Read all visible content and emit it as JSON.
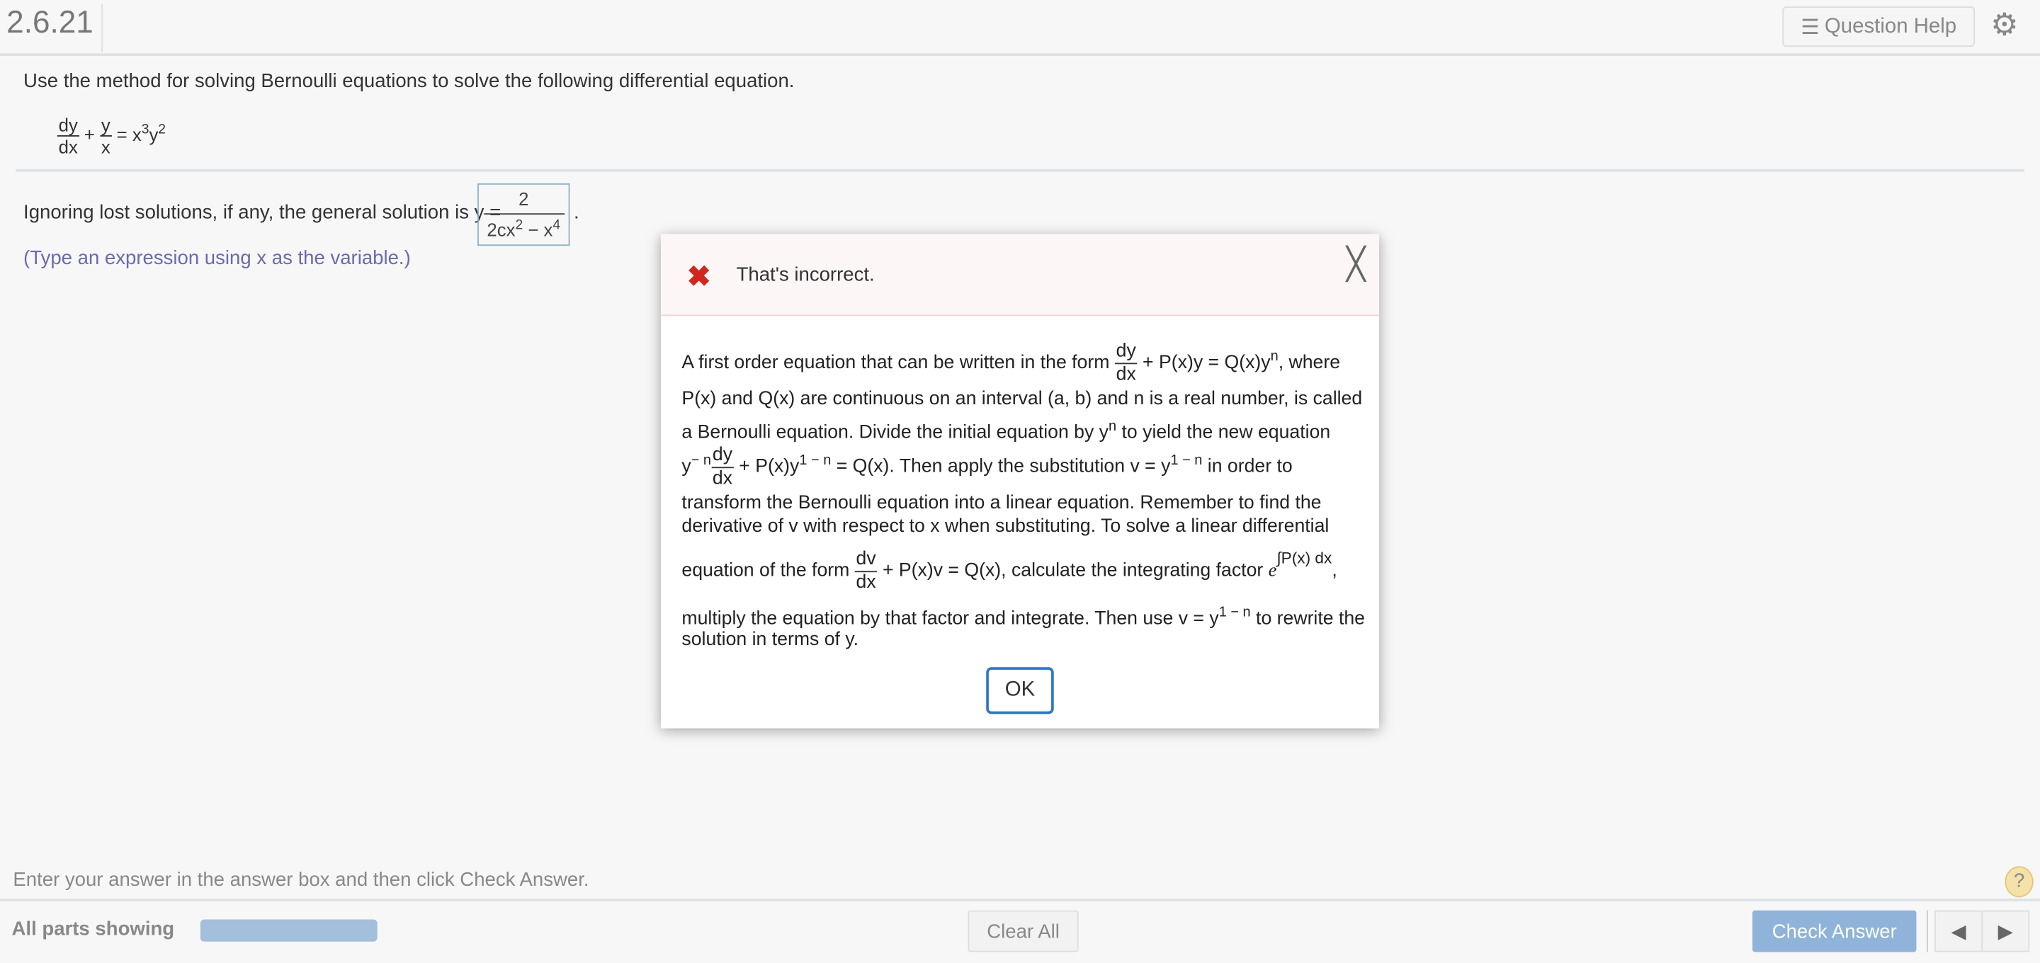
{
  "header": {
    "title": "2.6.21",
    "question_help": "Question Help",
    "icons": {
      "help": "list-icon",
      "settings": "gear-icon"
    }
  },
  "question": {
    "instruction": "Use the method for solving Bernoulli equations to solve the following differential equation.",
    "equation": {
      "num1": "dy",
      "den1": "dx",
      "plus": "+",
      "num2": "y",
      "den2": "x",
      "rhs": "= x",
      "exp1": "3",
      "y": "y",
      "exp2": "2"
    },
    "answer_prompt": "Ignoring lost solutions, if any, the general solution is y =",
    "answer": {
      "numerator": "2",
      "denominator": "2cx",
      "exp_a": "2",
      "minus": " − x",
      "exp_b": "4"
    },
    "period": ".",
    "hint": "(Type an expression using x as the variable.)"
  },
  "dialog": {
    "status": "That's incorrect.",
    "status_color": "#d0281f",
    "l1a": "A first order equation that can be written in the form ",
    "dy": "dy",
    "dx": "dx",
    "l1b": " + P(x)y = Q(x)y",
    "n": "n",
    "l1c": ", where",
    "l2": "P(x) and Q(x) are continuous on an interval (a, b) and n is a real number, is called",
    "l3a": "a Bernoulli equation. Divide the initial equation by y",
    "l3b": " to yield the new equation",
    "l4a": "y",
    "l4exp": "− n",
    "l4b": " + P(x)y",
    "l4exp2": "1 − n",
    "l4c": " = Q(x). Then apply the substitution v = y",
    "l4d": " in order to",
    "l5": "transform the Bernoulli equation into a linear equation. Remember to find the",
    "l6": "derivative of v with respect to x when substituting. To solve a linear differential",
    "l7a": "equation of the form ",
    "dv": "dv",
    "l7b": " + P(x)v = Q(x), calculate the integrating factor ",
    "e": "e",
    "integral": "∫P(x) dx",
    "comma": ",",
    "l8a": "multiply the equation by that factor and integrate. Then use v = y",
    "l8b": " to rewrite the",
    "l9": "solution in terms of y.",
    "ok": "OK"
  },
  "footer": {
    "message": "Enter your answer in the answer box and then click Check Answer.",
    "help": "?",
    "parts": "All parts showing",
    "progress_percent": 100,
    "clear_all": "Clear All",
    "check_answer": "Check Answer",
    "prev": "◀",
    "next": "▶"
  }
}
